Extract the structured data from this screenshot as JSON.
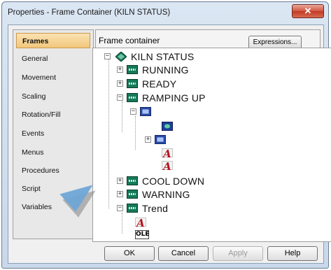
{
  "window": {
    "title": "Properties - Frame Container (KILN STATUS)",
    "close_glyph": "✕"
  },
  "sidebar": {
    "items": [
      {
        "label": "Frames",
        "active": true
      },
      {
        "label": "General"
      },
      {
        "label": "Movement"
      },
      {
        "label": "Scaling"
      },
      {
        "label": "Rotation/Fill"
      },
      {
        "label": "Events"
      },
      {
        "label": "Menus"
      },
      {
        "label": "Procedures"
      },
      {
        "label": "Script"
      },
      {
        "label": "Variables"
      }
    ]
  },
  "panel": {
    "label": "Frame container",
    "expressions_button": "Expressions..."
  },
  "tree": {
    "root": "KILN STATUS",
    "nodes": [
      {
        "label": "RUNNING",
        "icon": "frame-icon",
        "expander": "+"
      },
      {
        "label": "READY",
        "icon": "frame-icon",
        "expander": "+"
      },
      {
        "label": "RAMPING UP",
        "icon": "frame-icon",
        "expander": "−"
      },
      {
        "label": "COOL DOWN",
        "icon": "frame-icon",
        "expander": "+"
      },
      {
        "label": "WARNING",
        "icon": "frame-icon",
        "expander": "+"
      },
      {
        "label": "Trend",
        "icon": "frame-icon",
        "expander": "−"
      }
    ],
    "text_glyph": "A",
    "ole_label": "OLE"
  },
  "buttons": {
    "ok": "OK",
    "cancel": "Cancel",
    "apply": "Apply",
    "help": "Help"
  },
  "colors": {
    "active_tab": "#f2c77c",
    "frame_icon": "#157a57",
    "text_icon": "#b3121c",
    "close_button": "#d2543f"
  }
}
